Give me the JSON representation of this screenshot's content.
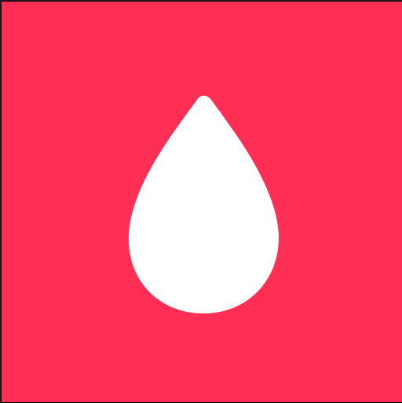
{
  "icon": {
    "name": "blood-drop-icon",
    "background_color": "#FF2E55",
    "glyph_color": "#FFFFFF"
  }
}
